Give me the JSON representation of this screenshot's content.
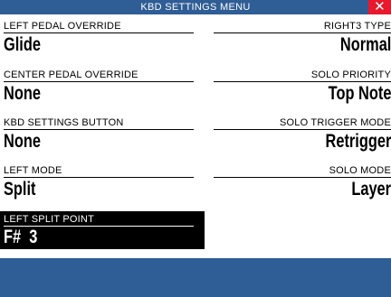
{
  "window": {
    "title": "KBD SETTINGS MENU",
    "close_glyph": "✕"
  },
  "left_fields": [
    {
      "label": "LEFT PEDAL OVERRIDE",
      "value": "Glide"
    },
    {
      "label": "CENTER PEDAL OVERRIDE",
      "value": "None"
    },
    {
      "label": "KBD SETTINGS BUTTON",
      "value": "None"
    },
    {
      "label": "LEFT MODE",
      "value": "Split"
    }
  ],
  "right_fields": [
    {
      "label": "RIGHT3 TYPE",
      "value": "Normal"
    },
    {
      "label": "SOLO PRIORITY",
      "value": "Top Note"
    },
    {
      "label": "SOLO TRIGGER MODE",
      "value": "Retrigger"
    },
    {
      "label": "SOLO MODE",
      "value": "Layer"
    }
  ],
  "selected_field": {
    "label": "LEFT SPLIT POINT",
    "value": "F#  3"
  },
  "colors": {
    "title_bar": "#2f5d95",
    "close_button": "#e8192c",
    "selection_bg": "#000000",
    "footer_bar": "#2f5d95"
  }
}
